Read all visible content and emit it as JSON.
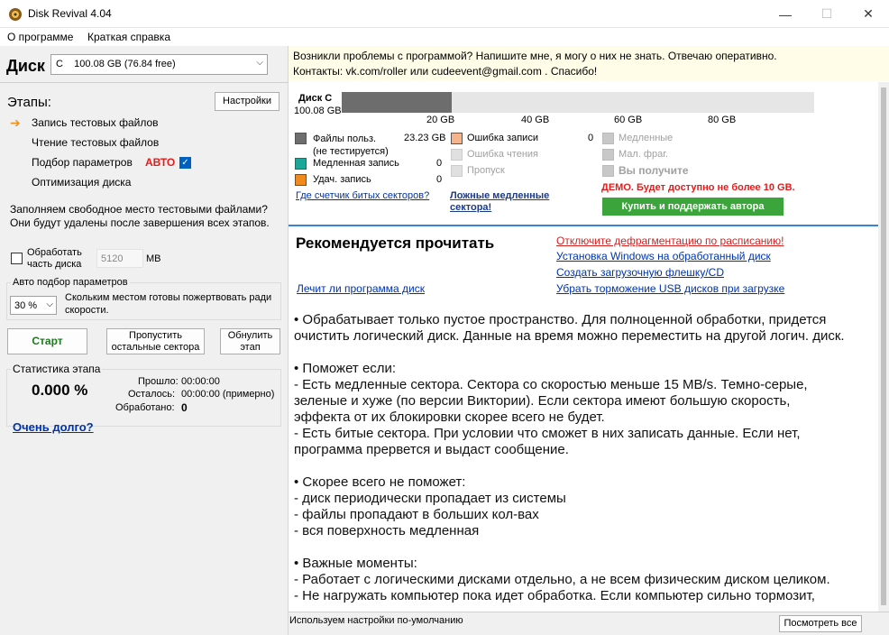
{
  "window": {
    "title": "Disk Revival 4.04",
    "minimize": "—",
    "maximize": "☐",
    "close": "✕"
  },
  "menu": [
    "О программе",
    "Краткая справка"
  ],
  "left": {
    "disk_label": "Диск",
    "disk_select": "C    100.08 GB (76.84 free)",
    "stages_title": "Этапы:",
    "settings_button": "Настройки",
    "stages": [
      "Запись тестовых файлов",
      "Чтение тестовых файлов",
      "Подбор параметров",
      "Оптимизация диска"
    ],
    "auto_label": "АВТО",
    "description": "Заполняем свободное место тестовыми файлами? Они будут удалены после завершения всех этапов.",
    "partial_label_1": "Обработать",
    "partial_label_2": "часть диска",
    "partial_value": "5120",
    "partial_unit": "MB",
    "auto_group_title": "Авто подбор параметров",
    "auto_percent": "30 %",
    "auto_desc": "Скольким местом готовы пожертвовать ради скорости.",
    "start_button": "Старт",
    "skip_button": "Пропустить остальные сектора",
    "reset_button": "Обнулить этап",
    "stats_title": "Статистика этапа",
    "stats_percent": "0.000 %",
    "passed_label": "Прошло:",
    "passed_value": "00:00:00",
    "left_label": "Осталось:",
    "left_value": "00:00:00 (примерно)",
    "processed_label": "Обработано:",
    "processed_value": "0",
    "too_long_link": "Очень долго?"
  },
  "right": {
    "notice_line1": "Возникли проблемы с программой? Напишите мне, я могу о них не знать. Отвечаю оперативно.",
    "notice_line2": "Контакты: vk.com/roller или cudeevent@gmail.com . Спасибо!",
    "disk_name": "Диск C",
    "disk_size": "100.08 GB",
    "bar_used_fraction": 0.2323,
    "ticks": [
      "20 GB",
      "40 GB",
      "60 GB",
      "80 GB"
    ],
    "legend": {
      "user_files": "Файлы польз.",
      "user_files_sub": "(не тестируется)",
      "user_files_value": "23.23 GB",
      "slow_write": "Медленная запись",
      "slow_write_value": "0",
      "deleted_write": "Удач. запись",
      "deleted_write_value": "0",
      "write_error": "Ошибка записи",
      "write_error_value": "0",
      "read_error": "Ошибка чтения",
      "skip": "Пропуск",
      "slow": "Медленные",
      "small_frag": "Мал. фраг.",
      "you_get": "Вы получите"
    },
    "colors": {
      "user": "#6d6d6d",
      "slow_write": "#1aa79a",
      "deleted": "#ef8b1e",
      "write_error": "#f5b48c",
      "buy": "#3ba53b"
    },
    "bad_sector_link": "Где счетчик битых секторов?",
    "false_slow_link_1": "Ложные медленные",
    "false_slow_link_2": "сектора!",
    "demo_text": "ДЕМО. Будет доступно не более 10 GB.",
    "buy_button": "Купить и поддержать автора",
    "recommend_title": "Рекомендуется прочитать",
    "links": [
      "Отключите дефрагментацию по расписанию!",
      "Установка Windows на обработанный диск",
      "Создать загрузочную флешку/CD",
      "Убрать торможение USB дисков при загрузке"
    ],
    "left_link": "Лечит ли программа диск",
    "body": [
      "• Обрабатывает только пустое пространство. Для полноценной обработки, придется",
      "очистить логический диск. Данные на время можно переместить на другой логич. диск.",
      "",
      "• Поможет если:",
      "- Есть медленные сектора. Сектора со скоростью меньше 15 MB/s. Темно-серые,",
      "зеленые и хуже (по версии Виктории). Если сектора имеют большую скорость,",
      "эффекта от их блокировки скорее всего не будет.",
      "- Есть битые сектора. При условии что сможет в них записать данные. Если нет,",
      "программа прервется и выдаст сообщение.",
      "",
      "• Скорее всего не поможет:",
      "- диск периодически пропадает из системы",
      "- файлы пропадают в больших кол-вах",
      "- вся поверхность медленная",
      "",
      "• Важные моменты:",
      "- Работает с логическими дисками отдельно, а не всем физическим диском целиком.",
      "- Не нагружать компьютер пока идет обработка. Если компьютер сильно тормозит,"
    ],
    "status_text": "Используем настройки по-умолчанию",
    "view_all_button": "Посмотреть все"
  }
}
